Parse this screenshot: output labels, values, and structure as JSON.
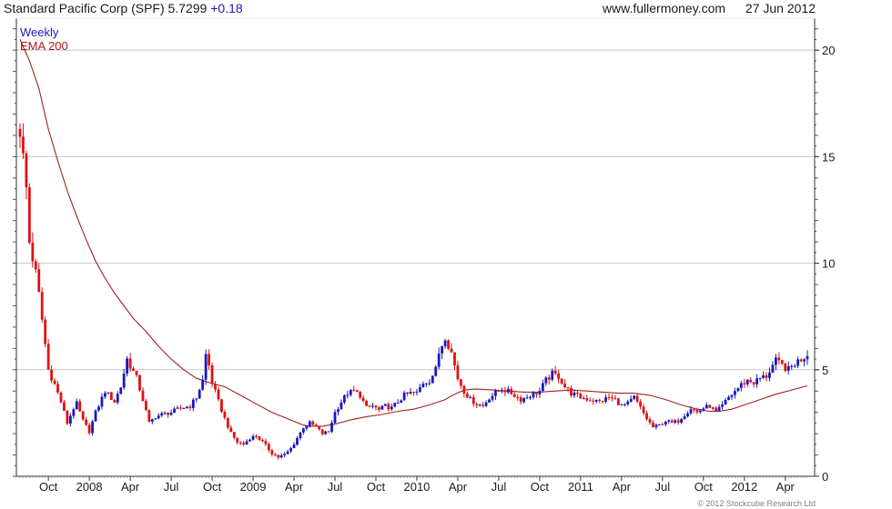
{
  "header": {
    "title": "Standard Pacific Corp (SPF) 5.7299",
    "change": "+0.18",
    "source": "www.fullermoney.com",
    "date": "27 Jun 2012"
  },
  "legend": {
    "series1": "Weekly",
    "series2": "EMA 200"
  },
  "footer": {
    "copyright": "© 2012 Stockcube Research Ltd"
  },
  "colors": {
    "up": "#1818c0",
    "down": "#e01010",
    "ema": "#a02020",
    "grid": "#c8c8c8"
  },
  "chart_data": {
    "type": "candlestick",
    "title": "Standard Pacific Corp (SPF) 5.7299 +0.18",
    "ylim": [
      0,
      21.5
    ],
    "yticks": [
      0,
      5,
      10,
      15,
      20
    ],
    "grid": true,
    "x_range_weeks": [
      0,
      250
    ],
    "xticks": [
      {
        "w": 9,
        "label": "Oct"
      },
      {
        "w": 22,
        "label": "2008"
      },
      {
        "w": 35,
        "label": "Apr"
      },
      {
        "w": 48,
        "label": "Jul"
      },
      {
        "w": 61,
        "label": "Oct"
      },
      {
        "w": 74,
        "label": "2009"
      },
      {
        "w": 87,
        "label": "Apr"
      },
      {
        "w": 100,
        "label": "Jul"
      },
      {
        "w": 113,
        "label": "Oct"
      },
      {
        "w": 126,
        "label": "2010"
      },
      {
        "w": 139,
        "label": "Apr"
      },
      {
        "w": 152,
        "label": "Jul"
      },
      {
        "w": 165,
        "label": "Oct"
      },
      {
        "w": 178,
        "label": "2011"
      },
      {
        "w": 191,
        "label": "Apr"
      },
      {
        "w": 204,
        "label": "Jul"
      },
      {
        "w": 217,
        "label": "Oct"
      },
      {
        "w": 230,
        "label": "2012"
      },
      {
        "w": 243,
        "label": "Apr"
      }
    ],
    "price_path": [
      [
        0,
        16.3
      ],
      [
        2,
        13.5
      ],
      [
        3,
        11.0
      ],
      [
        5,
        9.5
      ],
      [
        6,
        8.5
      ],
      [
        8,
        6.2
      ],
      [
        9,
        5.0
      ],
      [
        11,
        4.3
      ],
      [
        13,
        3.5
      ],
      [
        15,
        2.5
      ],
      [
        17,
        3.2
      ],
      [
        18,
        3.4
      ],
      [
        20,
        2.6
      ],
      [
        22,
        2.1
      ],
      [
        24,
        3.0
      ],
      [
        27,
        4.0
      ],
      [
        30,
        3.5
      ],
      [
        32,
        4.2
      ],
      [
        34,
        5.5
      ],
      [
        35,
        5.2
      ],
      [
        37,
        4.6
      ],
      [
        39,
        3.6
      ],
      [
        41,
        2.5
      ],
      [
        43,
        2.8
      ],
      [
        45,
        2.9
      ],
      [
        48,
        3.0
      ],
      [
        51,
        3.2
      ],
      [
        54,
        3.3
      ],
      [
        56,
        3.7
      ],
      [
        58,
        4.5
      ],
      [
        59,
        5.7
      ],
      [
        60,
        5.2
      ],
      [
        61,
        4.4
      ],
      [
        63,
        3.5
      ],
      [
        65,
        2.7
      ],
      [
        67,
        2.0
      ],
      [
        69,
        1.6
      ],
      [
        71,
        1.5
      ],
      [
        73,
        1.8
      ],
      [
        75,
        1.9
      ],
      [
        77,
        1.6
      ],
      [
        80,
        1.1
      ],
      [
        82,
        0.9
      ],
      [
        84,
        1.0
      ],
      [
        86,
        1.3
      ],
      [
        88,
        1.8
      ],
      [
        90,
        2.3
      ],
      [
        92,
        2.5
      ],
      [
        94,
        2.3
      ],
      [
        96,
        2.0
      ],
      [
        98,
        2.1
      ],
      [
        100,
        3.0
      ],
      [
        102,
        3.5
      ],
      [
        104,
        3.9
      ],
      [
        106,
        4.0
      ],
      [
        108,
        3.8
      ],
      [
        110,
        3.2
      ],
      [
        112,
        3.3
      ],
      [
        114,
        3.1
      ],
      [
        116,
        3.3
      ],
      [
        118,
        3.2
      ],
      [
        120,
        3.5
      ],
      [
        122,
        3.8
      ],
      [
        124,
        3.9
      ],
      [
        126,
        3.9
      ],
      [
        128,
        4.4
      ],
      [
        130,
        4.5
      ],
      [
        132,
        5.0
      ],
      [
        133,
        5.8
      ],
      [
        135,
        6.6
      ],
      [
        137,
        5.8
      ],
      [
        139,
        4.6
      ],
      [
        141,
        4.0
      ],
      [
        143,
        3.6
      ],
      [
        145,
        3.4
      ],
      [
        147,
        3.3
      ],
      [
        149,
        3.7
      ],
      [
        151,
        3.9
      ],
      [
        153,
        4.1
      ],
      [
        156,
        3.9
      ],
      [
        159,
        3.6
      ],
      [
        162,
        3.8
      ],
      [
        165,
        4.0
      ],
      [
        167,
        4.5
      ],
      [
        169,
        4.8
      ],
      [
        171,
        4.7
      ],
      [
        173,
        4.2
      ],
      [
        175,
        3.9
      ],
      [
        178,
        3.7
      ],
      [
        181,
        3.6
      ],
      [
        184,
        3.5
      ],
      [
        187,
        3.7
      ],
      [
        189,
        3.6
      ],
      [
        191,
        3.3
      ],
      [
        193,
        3.4
      ],
      [
        195,
        3.7
      ],
      [
        197,
        3.2
      ],
      [
        199,
        2.7
      ],
      [
        201,
        2.3
      ],
      [
        203,
        2.4
      ],
      [
        205,
        2.6
      ],
      [
        207,
        2.5
      ],
      [
        209,
        2.6
      ],
      [
        211,
        2.9
      ],
      [
        213,
        3.2
      ],
      [
        215,
        3.0
      ],
      [
        217,
        3.2
      ],
      [
        219,
        3.3
      ],
      [
        221,
        3.0
      ],
      [
        223,
        3.3
      ],
      [
        225,
        3.7
      ],
      [
        227,
        4.0
      ],
      [
        229,
        4.3
      ],
      [
        231,
        4.5
      ],
      [
        233,
        4.4
      ],
      [
        235,
        4.6
      ],
      [
        237,
        4.7
      ],
      [
        239,
        5.2
      ],
      [
        240,
        5.4
      ],
      [
        242,
        5.2
      ],
      [
        244,
        5.0
      ],
      [
        246,
        5.3
      ],
      [
        248,
        5.5
      ],
      [
        250,
        5.73
      ]
    ],
    "ema_path": [
      [
        0,
        20.5
      ],
      [
        3,
        19.5
      ],
      [
        6,
        18.2
      ],
      [
        9,
        16.3
      ],
      [
        12,
        14.8
      ],
      [
        15,
        13.4
      ],
      [
        18,
        12.2
      ],
      [
        21,
        11.1
      ],
      [
        24,
        10.1
      ],
      [
        27,
        9.3
      ],
      [
        30,
        8.6
      ],
      [
        33,
        8.0
      ],
      [
        36,
        7.4
      ],
      [
        40,
        6.8
      ],
      [
        44,
        6.1
      ],
      [
        48,
        5.5
      ],
      [
        52,
        5.0
      ],
      [
        56,
        4.6
      ],
      [
        60,
        4.4
      ],
      [
        65,
        4.2
      ],
      [
        70,
        3.8
      ],
      [
        75,
        3.4
      ],
      [
        80,
        3.0
      ],
      [
        85,
        2.7
      ],
      [
        90,
        2.4
      ],
      [
        92,
        2.35
      ],
      [
        96,
        2.35
      ],
      [
        100,
        2.45
      ],
      [
        105,
        2.65
      ],
      [
        110,
        2.8
      ],
      [
        115,
        2.9
      ],
      [
        120,
        3.05
      ],
      [
        125,
        3.15
      ],
      [
        130,
        3.35
      ],
      [
        135,
        3.6
      ],
      [
        138,
        3.85
      ],
      [
        141,
        4.05
      ],
      [
        145,
        4.1
      ],
      [
        150,
        4.05
      ],
      [
        155,
        4.0
      ],
      [
        160,
        3.95
      ],
      [
        165,
        3.95
      ],
      [
        170,
        4.0
      ],
      [
        175,
        4.05
      ],
      [
        180,
        4.0
      ],
      [
        185,
        3.95
      ],
      [
        190,
        3.9
      ],
      [
        195,
        3.9
      ],
      [
        200,
        3.8
      ],
      [
        205,
        3.6
      ],
      [
        210,
        3.35
      ],
      [
        215,
        3.15
      ],
      [
        219,
        3.05
      ],
      [
        222,
        3.05
      ],
      [
        226,
        3.15
      ],
      [
        230,
        3.35
      ],
      [
        235,
        3.6
      ],
      [
        240,
        3.85
      ],
      [
        245,
        4.05
      ],
      [
        250,
        4.25
      ]
    ]
  }
}
